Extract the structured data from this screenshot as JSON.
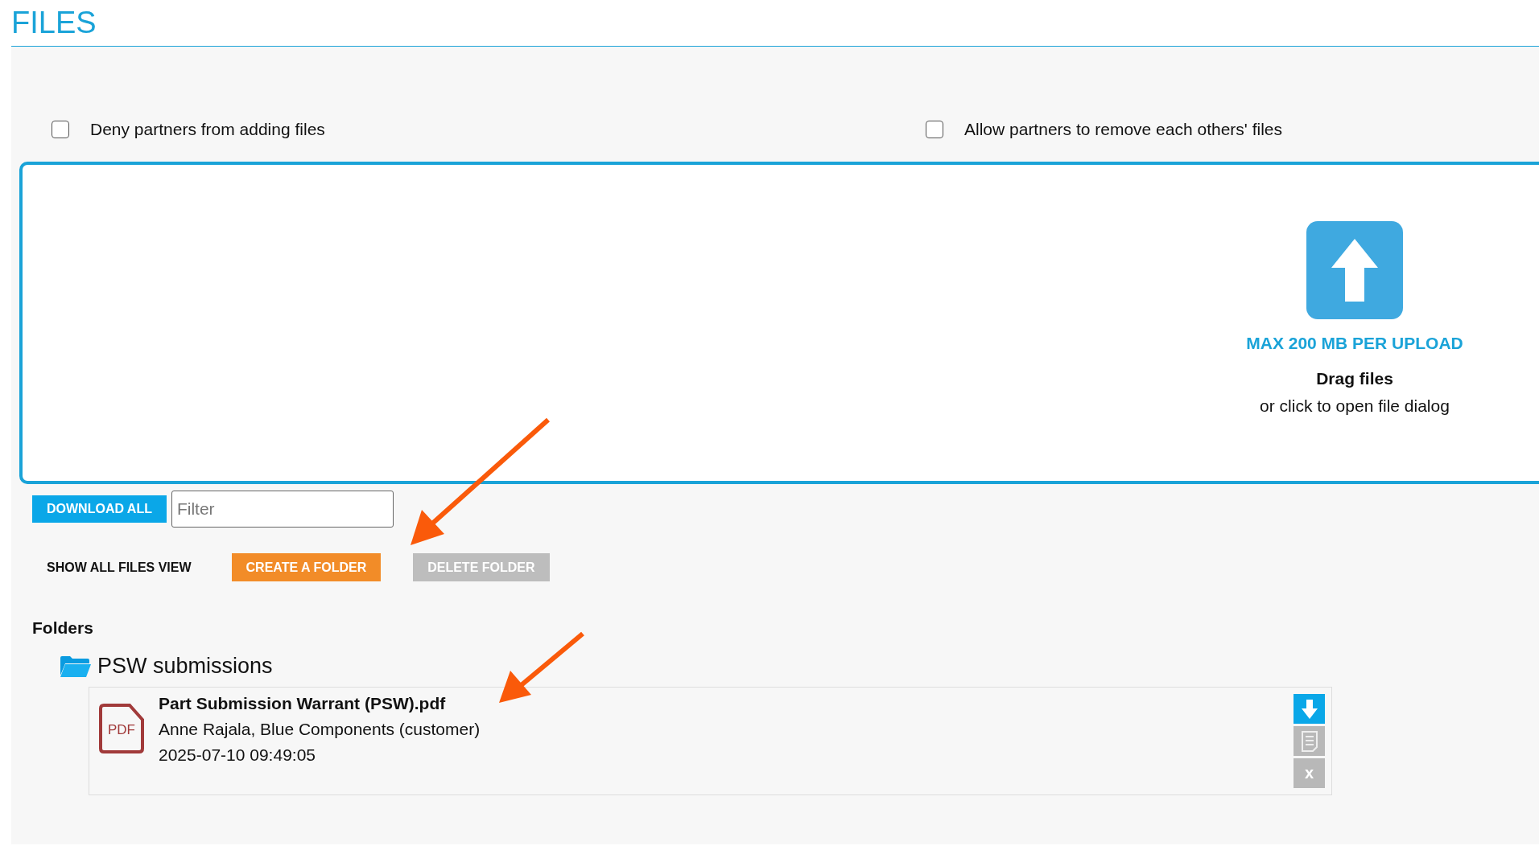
{
  "title": "FILES",
  "options": [
    {
      "label": "Deny partners from adding files",
      "checked": false
    },
    {
      "label": "Allow partners to remove each others' files",
      "checked": false
    }
  ],
  "upload": {
    "limit": "MAX 200 MB PER UPLOAD",
    "drag": "Drag files",
    "hint": "or click to open file dialog"
  },
  "toolbar": {
    "download_all": "DOWNLOAD ALL",
    "filter": {
      "placeholder": "Filter"
    },
    "buttons": [
      {
        "kind": "link",
        "label": "SHOW ALL FILES VIEW"
      },
      {
        "kind": "primary",
        "label": "CREATE A FOLDER",
        "disabled": false
      },
      {
        "kind": "primary",
        "label": "DELETE FOLDER",
        "disabled": true
      }
    ]
  },
  "folders_heading": "Folders",
  "folders": [
    {
      "name": "PSW submissions",
      "files": [
        {
          "type_label": "PDF",
          "name": "Part Submission Warrant (PSW).pdf",
          "author": "Anne Rajala, Blue Components (customer)",
          "date": "2025-07-10 09:49:05",
          "actions": [
            {
              "kind": "download",
              "disabled": false
            },
            {
              "kind": "details",
              "disabled": true
            },
            {
              "kind": "delete",
              "label": "x",
              "disabled": true
            }
          ]
        }
      ]
    }
  ]
}
